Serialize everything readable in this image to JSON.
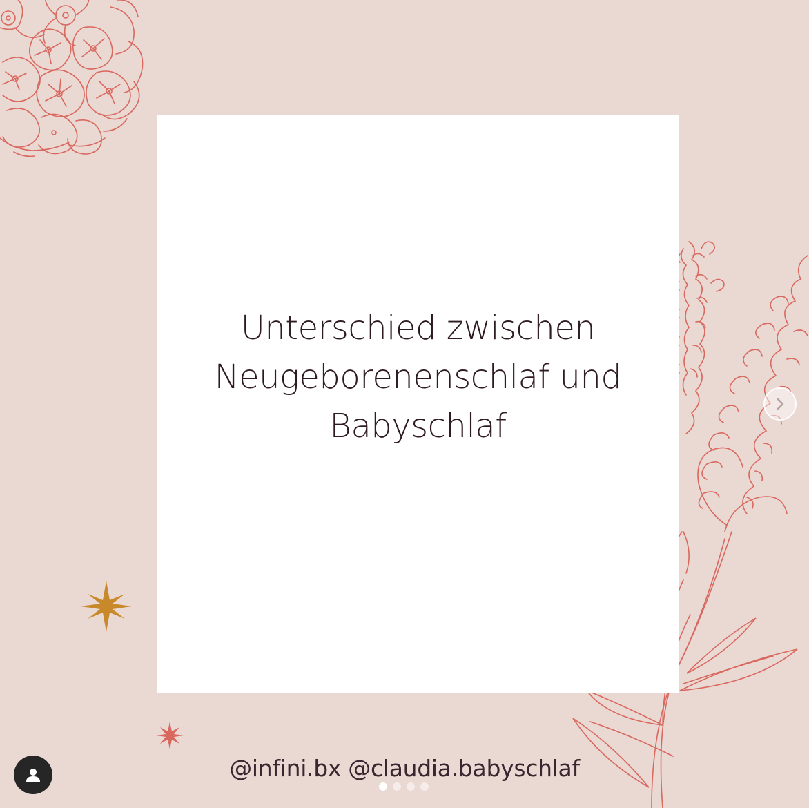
{
  "post": {
    "headline_lines": [
      "Unterschied zwischen",
      "Neugeborenenschlaf und",
      "Babyschlaf"
    ],
    "credit": "@infini.bx @claudia.babyschlaf"
  },
  "carousel": {
    "slide_count": 4,
    "active_index": 0
  },
  "controls": {
    "next_icon": "chevron-right-icon",
    "user_icon": "person-icon"
  },
  "colors": {
    "background": "#ead8d2",
    "card": "#ffffff",
    "text": "#2e1a22",
    "line_art": "#d9685f",
    "star_gold": "#c8892a",
    "star_coral": "#d9685f"
  }
}
